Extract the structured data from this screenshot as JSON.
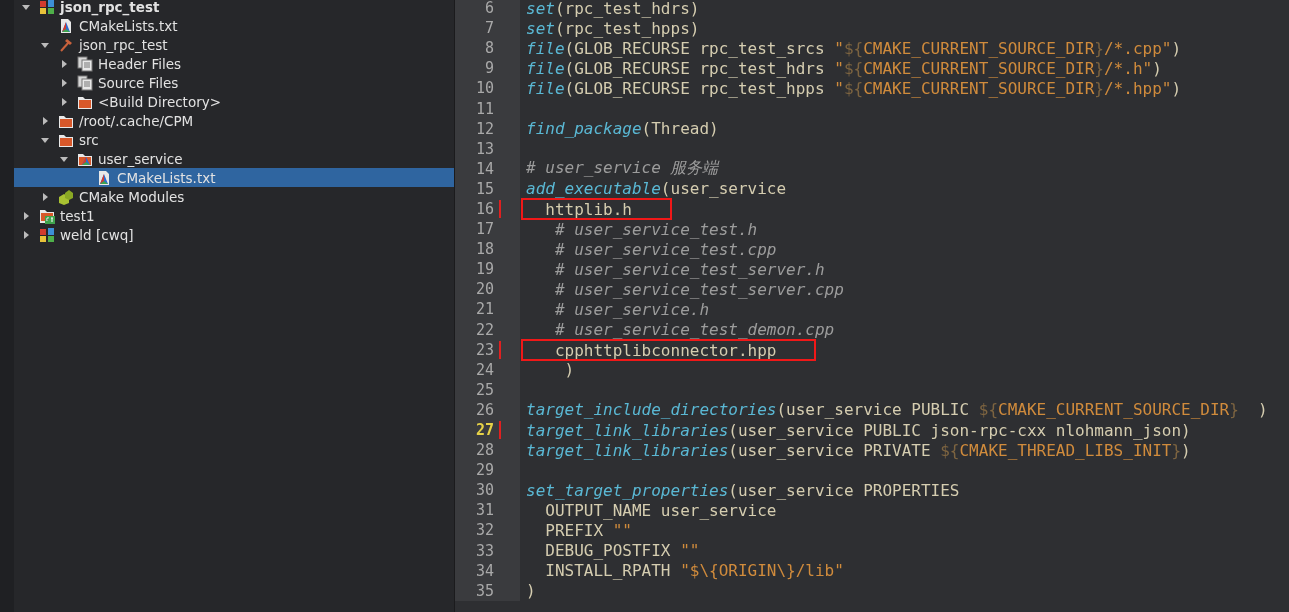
{
  "project_tree": [
    {
      "label": "json_rpc_test",
      "kind": "project",
      "bold": true,
      "expanded": true,
      "selected": false,
      "children": [
        {
          "label": "CMakeLists.txt",
          "kind": "cmake-file",
          "selected": false
        },
        {
          "label": "json_rpc_test",
          "kind": "hammer",
          "expanded": true,
          "selected": false,
          "children": [
            {
              "label": "Header Files",
              "kind": "file-group",
              "expanded": false,
              "selected": false
            },
            {
              "label": "Source Files",
              "kind": "file-group",
              "expanded": false,
              "selected": false
            },
            {
              "label": "<Build Directory>",
              "kind": "folder",
              "expanded": false,
              "selected": false
            }
          ]
        },
        {
          "label": "/root/.cache/CPM",
          "kind": "folder",
          "expanded": false,
          "selected": false
        },
        {
          "label": "src",
          "kind": "folder",
          "expanded": true,
          "selected": false,
          "children": [
            {
              "label": "user_service",
              "kind": "cmake-folder",
              "expanded": true,
              "selected": false,
              "children": [
                {
                  "label": "CMakeLists.txt",
                  "kind": "cmake-file",
                  "selected": true
                }
              ]
            }
          ]
        },
        {
          "label": "CMake Modules",
          "kind": "modules",
          "expanded": false,
          "selected": false
        }
      ]
    },
    {
      "label": "test1",
      "kind": "qt-project",
      "expanded": false,
      "selected": false
    },
    {
      "label": "weld [cwq]",
      "kind": "project",
      "expanded": false,
      "selected": false
    }
  ],
  "editor": {
    "lines": [
      {
        "number": "6",
        "tokens": [
          {
            "kind": "fn",
            "text": "set"
          },
          {
            "kind": "text",
            "text": "(rpc_test_hdrs)"
          }
        ]
      },
      {
        "number": "7",
        "tokens": [
          {
            "kind": "fn",
            "text": "set"
          },
          {
            "kind": "text",
            "text": "(rpc_test_hpps)"
          }
        ]
      },
      {
        "number": "8",
        "tokens": [
          {
            "kind": "fn",
            "text": "file"
          },
          {
            "kind": "text",
            "text": "(GLOB_RECURSE rpc_test_srcs "
          },
          {
            "kind": "string",
            "text": "\""
          },
          {
            "kind": "brace",
            "text": "${"
          },
          {
            "kind": "string",
            "text": "CMAKE_CURRENT_SOURCE_DIR"
          },
          {
            "kind": "brace",
            "text": "}"
          },
          {
            "kind": "string",
            "text": "/*.cpp\""
          },
          {
            "kind": "text",
            "text": ")"
          }
        ]
      },
      {
        "number": "9",
        "tokens": [
          {
            "kind": "fn",
            "text": "file"
          },
          {
            "kind": "text",
            "text": "(GLOB_RECURSE rpc_test_hdrs "
          },
          {
            "kind": "string",
            "text": "\""
          },
          {
            "kind": "brace",
            "text": "${"
          },
          {
            "kind": "string",
            "text": "CMAKE_CURRENT_SOURCE_DIR"
          },
          {
            "kind": "brace",
            "text": "}"
          },
          {
            "kind": "string",
            "text": "/*.h\""
          },
          {
            "kind": "text",
            "text": ")"
          }
        ]
      },
      {
        "number": "10",
        "tokens": [
          {
            "kind": "fn",
            "text": "file"
          },
          {
            "kind": "text",
            "text": "(GLOB_RECURSE rpc_test_hpps "
          },
          {
            "kind": "string",
            "text": "\""
          },
          {
            "kind": "brace",
            "text": "${"
          },
          {
            "kind": "string",
            "text": "CMAKE_CURRENT_SOURCE_DIR"
          },
          {
            "kind": "brace",
            "text": "}"
          },
          {
            "kind": "string",
            "text": "/*.hpp\""
          },
          {
            "kind": "text",
            "text": ")"
          }
        ]
      },
      {
        "number": "11"
      },
      {
        "number": "12",
        "tokens": [
          {
            "kind": "fn",
            "text": "find_package"
          },
          {
            "kind": "text",
            "text": "(Thread)"
          }
        ]
      },
      {
        "number": "13"
      },
      {
        "number": "14",
        "tokens": [
          {
            "kind": "comment",
            "text": "# user_service 服务端"
          }
        ]
      },
      {
        "number": "15",
        "tokens": [
          {
            "kind": "fn",
            "text": "add_executable"
          },
          {
            "kind": "text",
            "text": "(user_service"
          }
        ]
      },
      {
        "number": "16",
        "changed": true,
        "boxed": true,
        "tokens": [
          {
            "kind": "text",
            "text": "  httplib.h"
          }
        ]
      },
      {
        "number": "17",
        "tokens": [
          {
            "kind": "comment",
            "text": "   # user_service_test.h"
          }
        ]
      },
      {
        "number": "18",
        "tokens": [
          {
            "kind": "comment",
            "text": "   # user_service_test.cpp"
          }
        ]
      },
      {
        "number": "19",
        "tokens": [
          {
            "kind": "comment",
            "text": "   # user_service_test_server.h"
          }
        ]
      },
      {
        "number": "20",
        "tokens": [
          {
            "kind": "comment",
            "text": "   # user_service_test_server.cpp"
          }
        ]
      },
      {
        "number": "21",
        "tokens": [
          {
            "kind": "comment",
            "text": "   # user_service.h"
          }
        ]
      },
      {
        "number": "22",
        "tokens": [
          {
            "kind": "comment",
            "text": "   # user_service_test_demon.cpp"
          }
        ]
      },
      {
        "number": "23",
        "changed": true,
        "boxed": true,
        "tokens": [
          {
            "kind": "text",
            "text": "   cpphttplibconnector.hpp"
          }
        ]
      },
      {
        "number": "24",
        "tokens": [
          {
            "kind": "text",
            "text": "    )"
          }
        ]
      },
      {
        "number": "25"
      },
      {
        "number": "26",
        "tokens": [
          {
            "kind": "fn",
            "text": "target_include_directories"
          },
          {
            "kind": "text",
            "text": "(user_service PUBLIC "
          },
          {
            "kind": "brace",
            "text": "${"
          },
          {
            "kind": "string",
            "text": "CMAKE_CURRENT_SOURCE_DIR"
          },
          {
            "kind": "brace",
            "text": "}"
          },
          {
            "kind": "text",
            "text": "  )"
          }
        ]
      },
      {
        "number": "27",
        "changed": true,
        "current": true,
        "tokens": [
          {
            "kind": "fn",
            "text": "target_link_libraries"
          },
          {
            "kind": "text",
            "text": "(user_service PUBLIC json-rpc-cxx nlohmann_json)"
          }
        ]
      },
      {
        "number": "28",
        "tokens": [
          {
            "kind": "fn",
            "text": "target_link_libraries"
          },
          {
            "kind": "text",
            "text": "(user_service PRIVATE "
          },
          {
            "kind": "brace",
            "text": "${"
          },
          {
            "kind": "string",
            "text": "CMAKE_THREAD_LIBS_INIT"
          },
          {
            "kind": "brace",
            "text": "}"
          },
          {
            "kind": "text",
            "text": ")"
          }
        ]
      },
      {
        "number": "29"
      },
      {
        "number": "30",
        "tokens": [
          {
            "kind": "fn",
            "text": "set_target_properties"
          },
          {
            "kind": "text",
            "text": "(user_service PROPERTIES"
          }
        ]
      },
      {
        "number": "31",
        "tokens": [
          {
            "kind": "text",
            "text": "  OUTPUT_NAME user_service"
          }
        ]
      },
      {
        "number": "32",
        "tokens": [
          {
            "kind": "text",
            "text": "  PREFIX "
          },
          {
            "kind": "string",
            "text": "\"\""
          }
        ]
      },
      {
        "number": "33",
        "tokens": [
          {
            "kind": "text",
            "text": "  DEBUG_POSTFIX "
          },
          {
            "kind": "string",
            "text": "\"\""
          }
        ]
      },
      {
        "number": "34",
        "tokens": [
          {
            "kind": "text",
            "text": "  INSTALL_RPATH "
          },
          {
            "kind": "string",
            "text": "\"$\\{ORIGIN\\}/lib\""
          }
        ]
      },
      {
        "number": "35",
        "tokens": [
          {
            "kind": "text",
            "text": ")"
          }
        ]
      }
    ]
  }
}
